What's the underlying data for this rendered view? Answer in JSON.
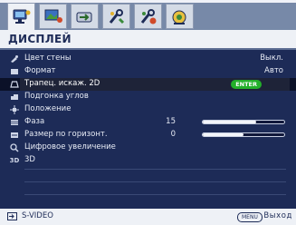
{
  "tabs": [
    {
      "icon": "display-icon",
      "active": true
    },
    {
      "icon": "picture-icon",
      "active": false
    },
    {
      "icon": "source-icon",
      "active": false
    },
    {
      "icon": "setup-basic-icon",
      "active": false
    },
    {
      "icon": "setup-advanced-icon",
      "active": false
    },
    {
      "icon": "info-icon",
      "active": false
    }
  ],
  "menu": {
    "title": "ДИСПЛЕЙ",
    "items": [
      {
        "label": "Цвет стены",
        "value": "Выкл.",
        "icon": "wall-color-icon"
      },
      {
        "label": "Формат",
        "value": "Авто",
        "icon": "aspect-ratio-icon"
      },
      {
        "label": "Трапец. искаж. 2D",
        "value": "ENTER",
        "icon": "keystone-icon",
        "selected": true
      },
      {
        "label": "Подгонка углов",
        "value": "",
        "icon": "corner-fit-icon"
      },
      {
        "label": "Положение",
        "value": "",
        "icon": "position-icon"
      },
      {
        "label": "Фаза",
        "value": "15",
        "icon": "phase-icon",
        "level": 0.65
      },
      {
        "label": "Размер по горизонт.",
        "value": "0",
        "icon": "h-size-icon",
        "level": 0.5
      },
      {
        "label": "Цифровое увеличение",
        "value": "",
        "icon": "digital-zoom-icon"
      },
      {
        "label": "3D",
        "value": "",
        "icon": "3d-icon",
        "icon_text": "3D"
      }
    ]
  },
  "footer": {
    "source": "S-VIDEO",
    "menu_key": "MENU",
    "exit": "Выход"
  }
}
